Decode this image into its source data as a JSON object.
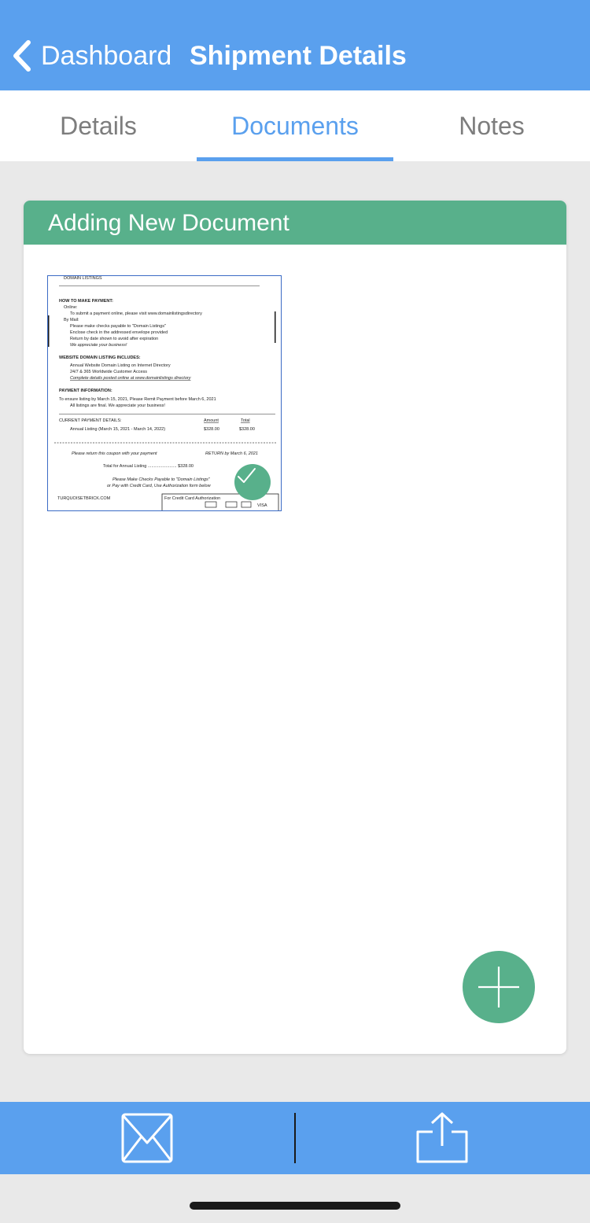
{
  "nav": {
    "back_label": "Dashboard",
    "title": "Shipment Details",
    "back_icon": "chevron-left-icon"
  },
  "tabs": [
    {
      "label": "Details",
      "active": false
    },
    {
      "label": "Documents",
      "active": true
    },
    {
      "label": "Notes",
      "active": false
    }
  ],
  "card": {
    "title": "Adding New Document",
    "document": {
      "texts": {
        "t1": "DOMAIN LISTINGS",
        "t2": "HOW TO MAKE PAYMENT:",
        "t3": "Online:",
        "t4": "To submit a payment online, please visit www.domainlistingsdirectory",
        "t5": "By Mail:",
        "t6": "Please make checks payable to \"Domain Listings\"",
        "t7": "Enclose check in the addressed envelope provided",
        "t8": "Return by date shown to avoid after expiration",
        "t9": "We appreciate your business!",
        "t10": "WEBSITE DOMAIN LISTING INCLUDES:",
        "t11": "Annual Website Domain Listing on Internet Directory",
        "t12": "24/7 & 365 Worldwide Customer Access",
        "t13": "Complete details posted online at www.domainlistings directory",
        "t14": "PAYMENT INFORMATION:",
        "t15": "To ensure listing by March 15, 2021, Please Remit Payment before March 6, 2021",
        "t16": "All listings are final. We appreciate your business!",
        "t17": "CURRENT PAYMENT DETAILS:",
        "t18": "Amount",
        "t19": "Total",
        "t20": "Annual Listing (March 15, 2021 - March 14, 2022)",
        "t21": "$328.00",
        "t22": "$328.00",
        "t23": "Please return this coupon with your payment",
        "t24": "RETURN by March 6, 2021",
        "t25": "Total for Annual Listing ........................ $328.00",
        "t26": "Please Make Checks Payable to \"Domain Listings\"",
        "t27": "or Pay with Credit Card, Use Authorization form below",
        "t28": "TURQUOISETBRICK.COM",
        "t29": "For Credit Card Authorization",
        "t30": "VISA"
      },
      "status": "selected",
      "status_icon": "checkmark-icon"
    }
  },
  "fab_icon": "plus-icon",
  "toolbar": {
    "mail_icon": "mail-icon",
    "share_icon": "share-icon"
  },
  "colors": {
    "nav_blue": "#5aa0ee",
    "accent_green": "#58b08b",
    "background": "#e9e9e9"
  }
}
